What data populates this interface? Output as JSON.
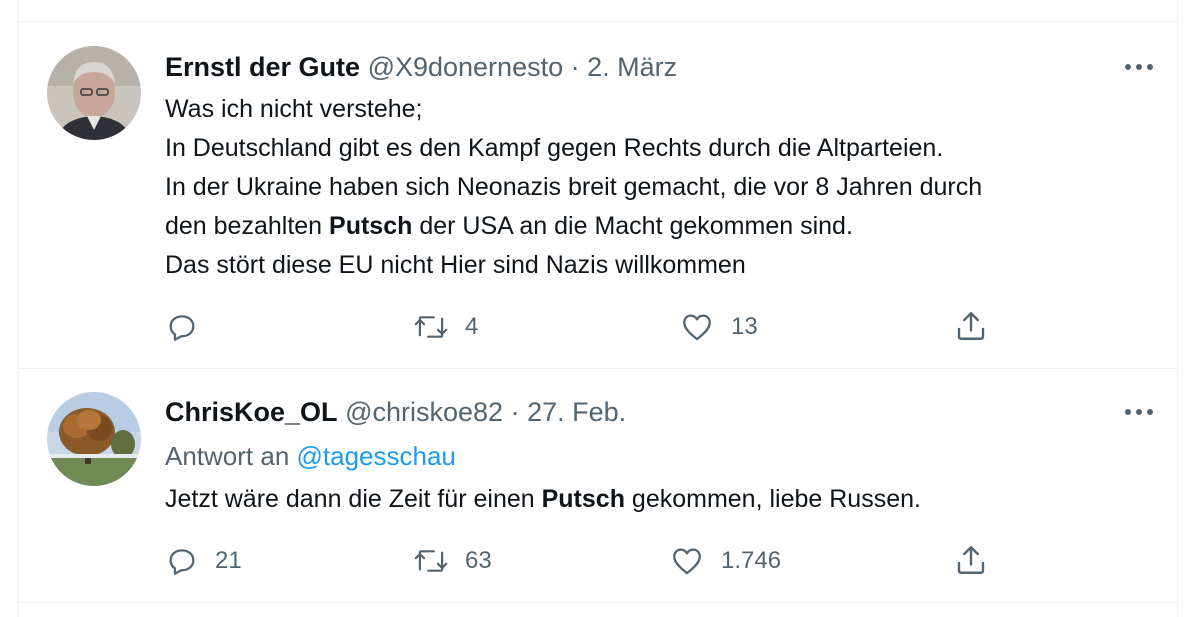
{
  "tweets": [
    {
      "name": "Ernstl der Gute",
      "handle": "@X9donernesto",
      "separator": "·",
      "date": "2. März",
      "lines": [
        {
          "text": "Was ich nicht verstehe;"
        },
        {
          "text": "In Deutschland gibt es den Kampf gegen Rechts durch die Altparteien."
        },
        {
          "text": "In der Ukraine haben sich Neonazis breit gemacht, die vor 8 Jahren durch"
        },
        {
          "before": "den bezahlten ",
          "bold": "Putsch",
          "after": " der USA an die Macht gekommen sind."
        },
        {
          "text": "Das stört diese EU nicht Hier sind Nazis willkommen"
        }
      ],
      "reply_count": "",
      "retweet_count": "4",
      "like_count": "13",
      "icons": {
        "reply": "reply-icon",
        "retweet": "retweet-icon",
        "like": "heart-icon",
        "share": "share-icon",
        "more": "more-icon"
      }
    },
    {
      "name": "ChrisKoe_OL",
      "handle": "@chriskoe82",
      "separator": "·",
      "date": "27. Feb.",
      "reply_to_prefix": "Antwort an ",
      "reply_to_handle": "@tagesschau",
      "lines": [
        {
          "before": "Jetzt wäre dann die Zeit für einen ",
          "bold": "Putsch",
          "after": " gekommen, liebe Russen."
        }
      ],
      "reply_count": "21",
      "retweet_count": "63",
      "like_count": "1.746",
      "icons": {
        "reply": "reply-icon",
        "retweet": "retweet-icon",
        "like": "heart-icon",
        "share": "share-icon",
        "more": "more-icon"
      }
    }
  ],
  "colors": {
    "text": "#0f1419",
    "secondary": "#536471",
    "link": "#1d9bf0",
    "divider": "#eff3f4"
  }
}
